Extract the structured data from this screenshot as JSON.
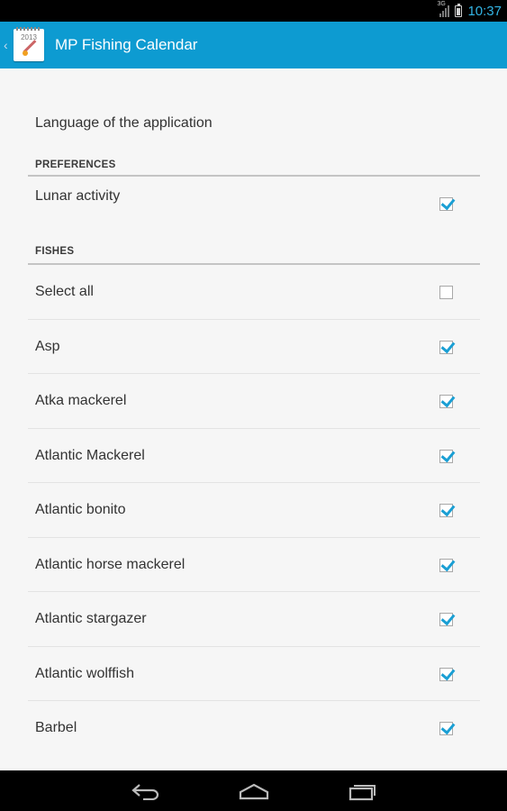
{
  "status_bar": {
    "time": "10:37",
    "network": "3G"
  },
  "action_bar": {
    "title": "MP Fishing Calendar",
    "icon_year": "2013"
  },
  "settings": {
    "language_label": "Language of the application",
    "preferences_header": "PREFERENCES",
    "lunar_label": "Lunar activity",
    "lunar_checked": true,
    "fishes_header": "FISHES",
    "fishes": [
      {
        "label": "Select all",
        "checked": false
      },
      {
        "label": "Asp",
        "checked": true
      },
      {
        "label": "Atka mackerel",
        "checked": true
      },
      {
        "label": "Atlantic Mackerel",
        "checked": true
      },
      {
        "label": "Atlantic bonito",
        "checked": true
      },
      {
        "label": "Atlantic horse mackerel",
        "checked": true
      },
      {
        "label": "Atlantic stargazer",
        "checked": true
      },
      {
        "label": "Atlantic wolffish",
        "checked": true
      },
      {
        "label": "Barbel",
        "checked": true
      }
    ]
  },
  "colors": {
    "action_bar": "#0d9bd1",
    "accent": "#33b5e5",
    "checkmark": "#1a9fd4"
  },
  "nav_icons": [
    "back-icon",
    "home-icon",
    "recent-apps-icon"
  ]
}
